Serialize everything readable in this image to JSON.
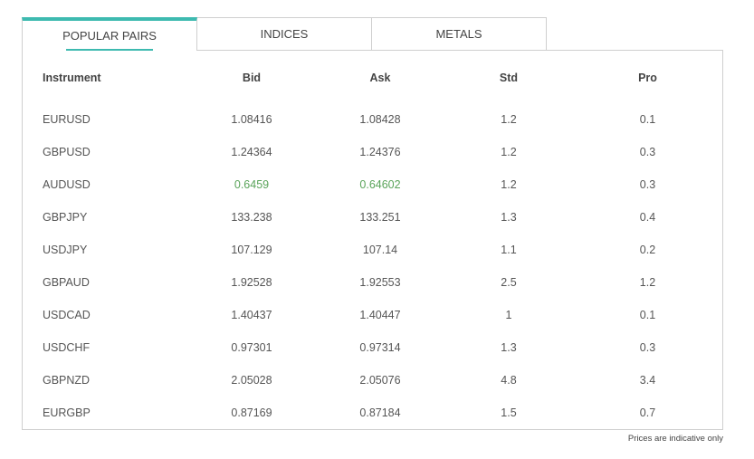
{
  "tabs": [
    {
      "label": "POPULAR PAIRS",
      "active": true
    },
    {
      "label": "INDICES",
      "active": false
    },
    {
      "label": "METALS",
      "active": false
    }
  ],
  "accent_color": "#3dbab0",
  "up_color": "#5aa45a",
  "table": {
    "headers": [
      "Instrument",
      "Bid",
      "Ask",
      "Std",
      "Pro"
    ],
    "rows": [
      [
        "EURUSD",
        "1.08416",
        "1.08428",
        "1.2",
        "0.1"
      ],
      [
        "GBPUSD",
        "1.24364",
        "1.24376",
        "1.2",
        "0.3"
      ],
      [
        "AUDUSD",
        "0.6459",
        "0.64602",
        "1.2",
        "0.3"
      ],
      [
        "GBPJPY",
        "133.238",
        "133.251",
        "1.3",
        "0.4"
      ],
      [
        "USDJPY",
        "107.129",
        "107.14",
        "1.1",
        "0.2"
      ],
      [
        "GBPAUD",
        "1.92528",
        "1.92553",
        "2.5",
        "1.2"
      ],
      [
        "USDCAD",
        "1.40437",
        "1.40447",
        "1",
        "0.1"
      ],
      [
        "USDCHF",
        "0.97301",
        "0.97314",
        "1.3",
        "0.3"
      ],
      [
        "GBPNZD",
        "2.05028",
        "2.05076",
        "4.8",
        "3.4"
      ],
      [
        "EURGBP",
        "0.87169",
        "0.87184",
        "1.5",
        "0.7"
      ]
    ],
    "highlighted_rows": [
      2
    ]
  },
  "footer_note": "Prices are indicative only"
}
